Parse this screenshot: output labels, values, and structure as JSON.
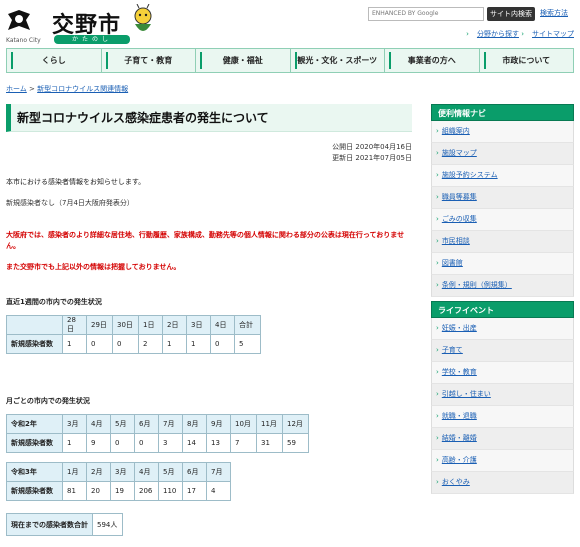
{
  "header": {
    "logo_jp": "交野市",
    "logo_en": "Katano City",
    "logo_kana": "かたのし",
    "search_placeholder": "ENHANCED BY Google",
    "search_button": "サイト内検索",
    "search_help": "検索方法",
    "util_links": [
      "分野から探す",
      "サイトマップ"
    ]
  },
  "gnav": [
    "くらし",
    "子育て・教育",
    "健康・福祉",
    "観光・文化・スポーツ",
    "事業者の方へ",
    "市政について"
  ],
  "breadcrumb": {
    "home": "ホーム",
    "sep": ">",
    "current": "新型コロナウイルス関連情報"
  },
  "main": {
    "title": "新型コロナウイルス感染症患者の発生について",
    "published": "公開日 2020年04月16日",
    "updated": "更新日 2021年07月05日",
    "intro": "本市における感染者情報をお知らせします。",
    "new_cases": "新規感染者なし（7月4日大阪府発表分）",
    "red1": "大阪府では、感染者のより詳細な居住地、行動履歴、家族構成、勤務先等の個人情報に関わる部分の公表は現在行っておりません。",
    "red2": "また交野市でも上記以外の情報は把握しておりません。",
    "sec1": "直近1週間の市内での発生状況",
    "sec2": "月ごとの市内での発生状況"
  },
  "weekly": {
    "headers": [
      "28日",
      "29日",
      "30日",
      "1日",
      "2日",
      "3日",
      "4日",
      "合計"
    ],
    "row_label": "新規感染者数",
    "values": [
      "1",
      "0",
      "0",
      "2",
      "1",
      "1",
      "0",
      "5"
    ]
  },
  "monthly_2020": {
    "year_label": "令和2年",
    "headers": [
      "3月",
      "4月",
      "5月",
      "6月",
      "7月",
      "8月",
      "9月",
      "10月",
      "11月",
      "12月"
    ],
    "row_label": "新規感染者数",
    "values": [
      "1",
      "9",
      "0",
      "0",
      "3",
      "14",
      "13",
      "7",
      "31",
      "59"
    ]
  },
  "monthly_2021": {
    "year_label": "令和3年",
    "headers": [
      "1月",
      "2月",
      "3月",
      "4月",
      "5月",
      "6月",
      "7月"
    ],
    "row_label": "新規感染者数",
    "values": [
      "81",
      "20",
      "19",
      "206",
      "110",
      "17",
      "4"
    ]
  },
  "total": {
    "label": "現在までの感染者数合計",
    "value": "594人"
  },
  "sidebar": {
    "navi_title": "便利情報ナビ",
    "navi_items": [
      "組織案内",
      "施設マップ",
      "施設予約システム",
      "職員等募集",
      "ごみの収集",
      "市民相談",
      "図書館",
      "条例・規則（例規集）"
    ],
    "life_title": "ライフイベント",
    "life_items": [
      "妊娠・出産",
      "子育て",
      "学校・教育",
      "引越し・住まい",
      "就職・退職",
      "結婚・離婚",
      "高齢・介護",
      "おくやみ"
    ]
  },
  "colors": {
    "accent": "#0a9d6a",
    "alert": "#d40000",
    "table_header": "#dff0f7"
  }
}
